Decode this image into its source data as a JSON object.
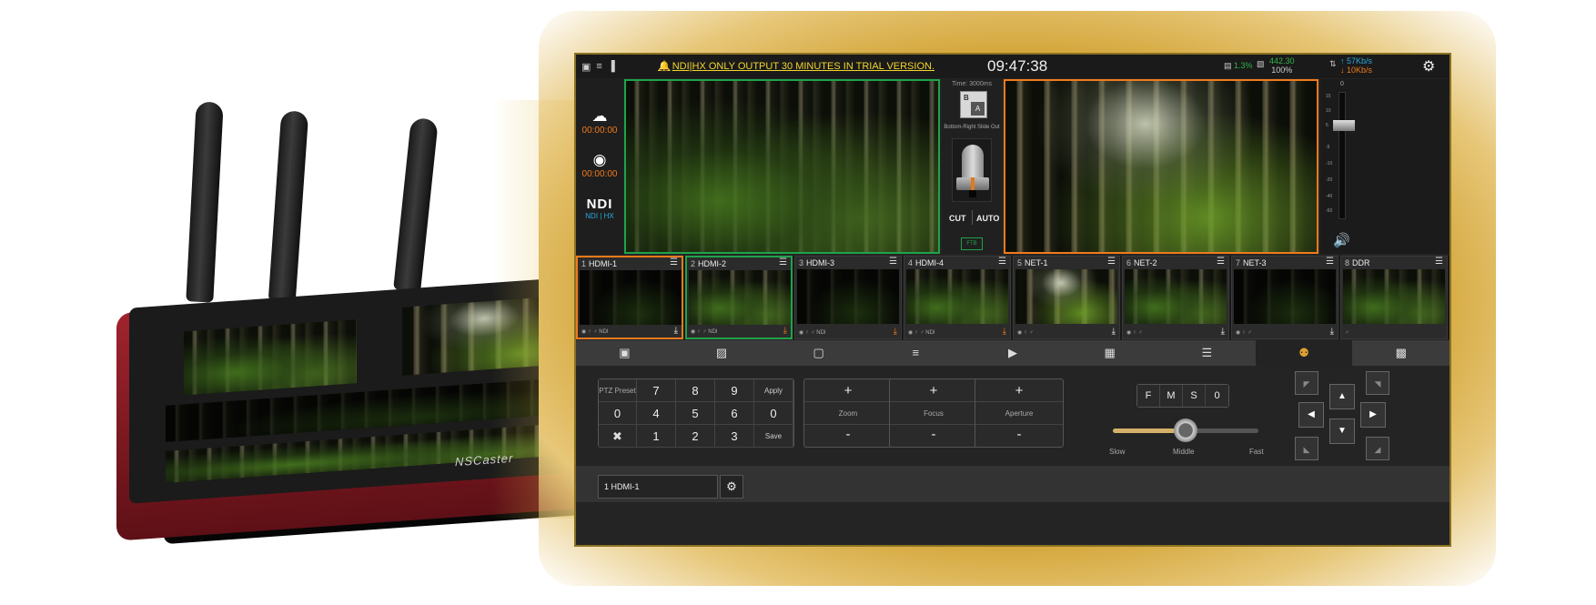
{
  "device": {
    "brand": "NSCaster"
  },
  "topbar": {
    "notice": "NDI|HX ONLY OUTPUT 30 MINUTES IN TRIAL VERSION.",
    "clock": "09:47:38",
    "cpu": "1.3%",
    "disk_used": "442.30",
    "disk_pct": "100%",
    "net_up": "↑ 57Kb/s",
    "net_down": "↓ 10Kb/s",
    "icons": [
      "network-icon",
      "wifi-icon",
      "signal-icon",
      "bell-icon",
      "cpu-icon",
      "disk-icon",
      "gear-icon"
    ]
  },
  "status": {
    "stream_time": "00:00:00",
    "record_time": "00:00:00",
    "ndi_label": "NDI",
    "ndi_sub": "NDI | HX"
  },
  "transition": {
    "time": "Time: 3000ms",
    "icon_b": "B",
    "icon_a": "A",
    "name": "Bottom-Right Slide Out",
    "cut": "CUT",
    "auto": "AUTO",
    "ftb": "FTB"
  },
  "audio": {
    "zero": "0",
    "scale": [
      "15",
      "10",
      "5",
      "-5",
      "-10",
      "-20",
      "-40",
      "-60"
    ],
    "level": 0.78
  },
  "sources": [
    {
      "num": "1",
      "name": "HDMI-1",
      "footer": "◉ ♇ ♂ NDI",
      "state": "pgm",
      "hot": false
    },
    {
      "num": "2",
      "name": "HDMI-2",
      "footer": "◉ ♇ ♂ NDI",
      "state": "pvw",
      "hot": true
    },
    {
      "num": "3",
      "name": "HDMI-3",
      "footer": "◉ ♇ ♂ NDI",
      "state": "",
      "hot": true
    },
    {
      "num": "4",
      "name": "HDMI-4",
      "footer": "◉ ♇ ♂ NDI",
      "state": "",
      "hot": true
    },
    {
      "num": "5",
      "name": "NET-1",
      "footer": "◉ ♇ ♂",
      "state": "",
      "hot": false
    },
    {
      "num": "6",
      "name": "NET-2",
      "footer": "◉ ♇ ♂",
      "state": "",
      "hot": false
    },
    {
      "num": "7",
      "name": "NET-3",
      "footer": "◉ ♇ ♂",
      "state": "",
      "hot": false
    },
    {
      "num": "8",
      "name": "DDR",
      "footer": "♂",
      "state": "",
      "hot": false
    }
  ],
  "tabs": [
    {
      "icon": "image-icon",
      "glyph": "▣"
    },
    {
      "icon": "image-overlay-icon",
      "glyph": "▨"
    },
    {
      "icon": "picture-in-picture-icon",
      "glyph": "▢"
    },
    {
      "icon": "audio-mixer-icon",
      "glyph": "≡"
    },
    {
      "icon": "media-folder-icon",
      "glyph": "▶"
    },
    {
      "icon": "scoreboard-icon",
      "glyph": "▦"
    },
    {
      "icon": "script-icon",
      "glyph": "☰"
    },
    {
      "icon": "ptz-camera-icon",
      "glyph": "⚉"
    },
    {
      "icon": "settings-layout-icon",
      "glyph": "▩"
    }
  ],
  "ptz": {
    "preset_label": "PTZ Preset",
    "keys": [
      "7",
      "8",
      "9",
      "4",
      "5",
      "6",
      "1",
      "2",
      "3"
    ],
    "preset_value": "0",
    "apply": "Apply",
    "value_zero": "0",
    "save": "Save",
    "clear": "✖",
    "zoom": {
      "plus": "+",
      "label": "Zoom",
      "minus": "-"
    },
    "focus": {
      "plus": "+",
      "label": "Focus",
      "minus": "-"
    },
    "aperture": {
      "plus": "+",
      "label": "Aperture",
      "minus": "-"
    },
    "speed_buttons": [
      "F",
      "M",
      "S",
      "0"
    ],
    "speed_slow": "Slow",
    "speed_middle": "Middle",
    "speed_fast": "Fast",
    "speed_level": 0.5
  },
  "bottom": {
    "camera": "1 HDMI-1"
  }
}
